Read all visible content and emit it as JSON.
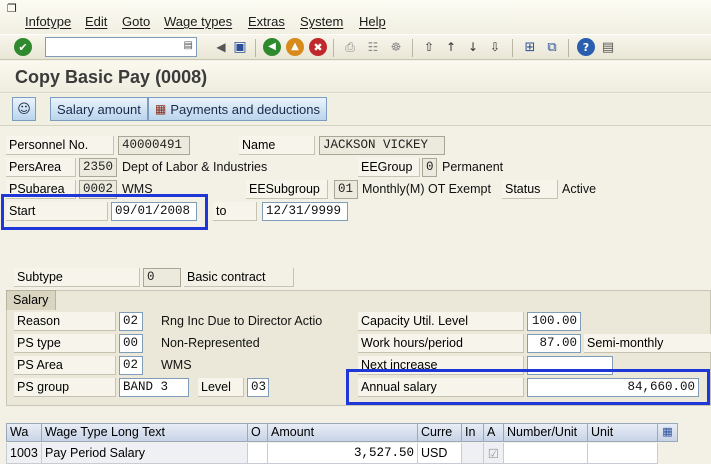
{
  "menu": {
    "items": [
      "Infotype",
      "Edit",
      "Goto",
      "Wage types",
      "Extras",
      "System",
      "Help"
    ]
  },
  "toolbar": {
    "command_value": ""
  },
  "page": {
    "title": "Copy Basic Pay (0008)"
  },
  "app_toolbar": {
    "salary_amount": "Salary amount",
    "payments_deductions": "Payments and deductions"
  },
  "header": {
    "personnel_no_label": "Personnel No.",
    "personnel_no": "40000491",
    "name_label": "Name",
    "name": "JACKSON VICKEY",
    "persarea_label": "PersArea",
    "persarea_code": "2350",
    "persarea_text": "Dept of Labor & Industries",
    "eegroup_label": "EEGroup",
    "eegroup_code": "0",
    "eegroup_text": "Permanent",
    "psubarea_label": "PSubarea",
    "psubarea_code": "0002",
    "psubarea_text": "WMS",
    "eesubgroup_label": "EESubgroup",
    "eesubgroup_code": "01",
    "eesubgroup_text": "Monthly(M) OT Exempt",
    "status_label": "Status",
    "status_value": "Active",
    "start_label": "Start",
    "start_date": "09/01/2008",
    "to_label": "to",
    "end_date": "12/31/9999"
  },
  "subtype": {
    "label": "Subtype",
    "code": "0",
    "text": "Basic contract"
  },
  "salary": {
    "group_title": "Salary",
    "reason_label": "Reason",
    "reason_code": "02",
    "reason_text": "Rng Inc Due to Director Actio",
    "pstype_label": "PS type",
    "pstype_code": "00",
    "pstype_text": "Non-Represented",
    "psarea_label": "PS Area",
    "psarea_code": "02",
    "psarea_text": "WMS",
    "psgroup_label": "PS group",
    "psgroup_value": "BAND 3",
    "level_label": "Level",
    "level_value": "03",
    "capacity_label": "Capacity Util. Level",
    "capacity_value": "100.00",
    "workhours_label": "Work hours/period",
    "workhours_value": "87.00",
    "workhours_period": "Semi-monthly",
    "nextinc_label": "Next increase",
    "nextinc_value": "",
    "annual_label": "Annual salary",
    "annual_value": "84,660.00"
  },
  "grid": {
    "headers": [
      "Wa",
      "Wage Type Long Text",
      "O",
      "Amount",
      "Curre",
      "In",
      "A",
      "Number/Unit",
      "Unit"
    ],
    "rows": [
      {
        "wt": "1003",
        "text": "Pay Period Salary",
        "o": "",
        "amount": "3,527.50",
        "curr": "USD",
        "in": "",
        "a": "☑",
        "num": "",
        "unit": ""
      }
    ]
  },
  "colors": {
    "highlight": "#1f37d6",
    "title_text": "#3b3b3b"
  }
}
